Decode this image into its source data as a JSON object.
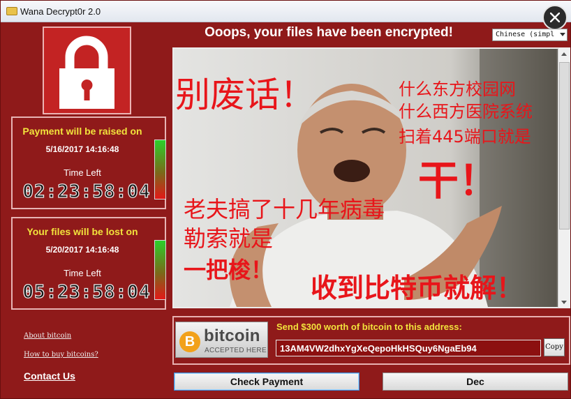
{
  "window": {
    "title": "Wana Decrypt0r 2.0"
  },
  "header": {
    "headline": "Ooops, your files have been encrypted!",
    "language": "Chinese (simpl"
  },
  "timers": [
    {
      "title": "Payment will be raised on",
      "date": "5/16/2017 14:16:48",
      "label": "Time Left",
      "countdown": "02:23:58:04"
    },
    {
      "title": "Your files will be lost on",
      "date": "5/20/2017 14:16:48",
      "label": "Time Left",
      "countdown": "05:23:58:04"
    }
  ],
  "links": {
    "about_bitcoin": "About bitcoin",
    "how_to_buy": "How to buy bitcoins?",
    "contact_us": "Contact Us"
  },
  "image_text": {
    "line1": "别废话！",
    "line2": [
      "什么东方校园网",
      "什么西方医院系统",
      "扫着445端口就是"
    ],
    "line3": "干！",
    "line4": [
      "老夫搞了十几年病毒",
      "勒索就是"
    ],
    "line5": "一把梭！",
    "line6": "收到比特币就解！"
  },
  "bitcoin": {
    "logo_word": "bitcoin",
    "logo_sub": "ACCEPTED HERE",
    "coin_symbol": "B",
    "send_text": "Send $300 worth of bitcoin to this address:",
    "address": "13AM4VW2dhxYgXeQepoHkHSQuy6NgaEb94",
    "copy_label": "Copy"
  },
  "buttons": {
    "check_payment": "Check Payment",
    "decrypt": "Dec"
  },
  "colors": {
    "window_bg": "#8f1a1a",
    "accent_yellow": "#f2e33c",
    "lock_red": "#c32323",
    "text_red": "#e8151a"
  }
}
